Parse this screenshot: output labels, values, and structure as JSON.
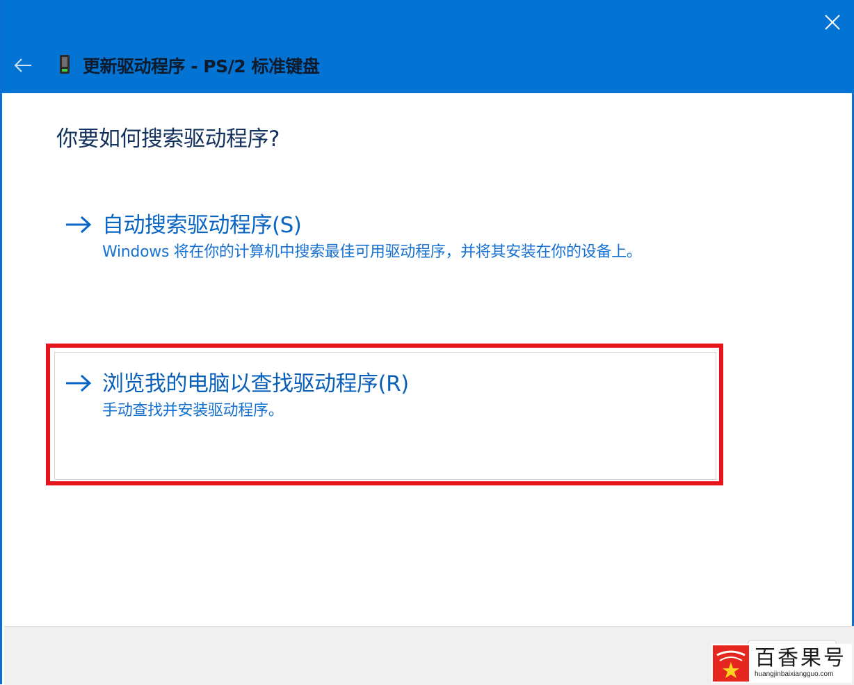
{
  "window": {
    "title": "更新驱动程序 - PS/2 标准键盘",
    "titlebar_color": "#0374d3",
    "back_icon": "back-arrow-icon",
    "device_icon": "keyboard-device-icon",
    "close_icon": "close-icon"
  },
  "main": {
    "question": "你要如何搜索驱动程序?",
    "accent_color": "#0865c3",
    "options": [
      {
        "icon": "right-arrow-icon",
        "title": "自动搜索驱动程序(S)",
        "description": "Windows 将在你的计算机中搜索最佳可用驱动程序，并将其安装在你的设备上。"
      },
      {
        "icon": "right-arrow-icon",
        "title": "浏览我的电脑以查找驱动程序(R)",
        "description": "手动查找并安装驱动程序。",
        "highlighted": true,
        "highlight_color": "#e8141d"
      }
    ]
  },
  "watermark": {
    "name": "百香果号",
    "url": "huangjinbaixiangguo.com",
    "logo_color": "#e6271f"
  }
}
